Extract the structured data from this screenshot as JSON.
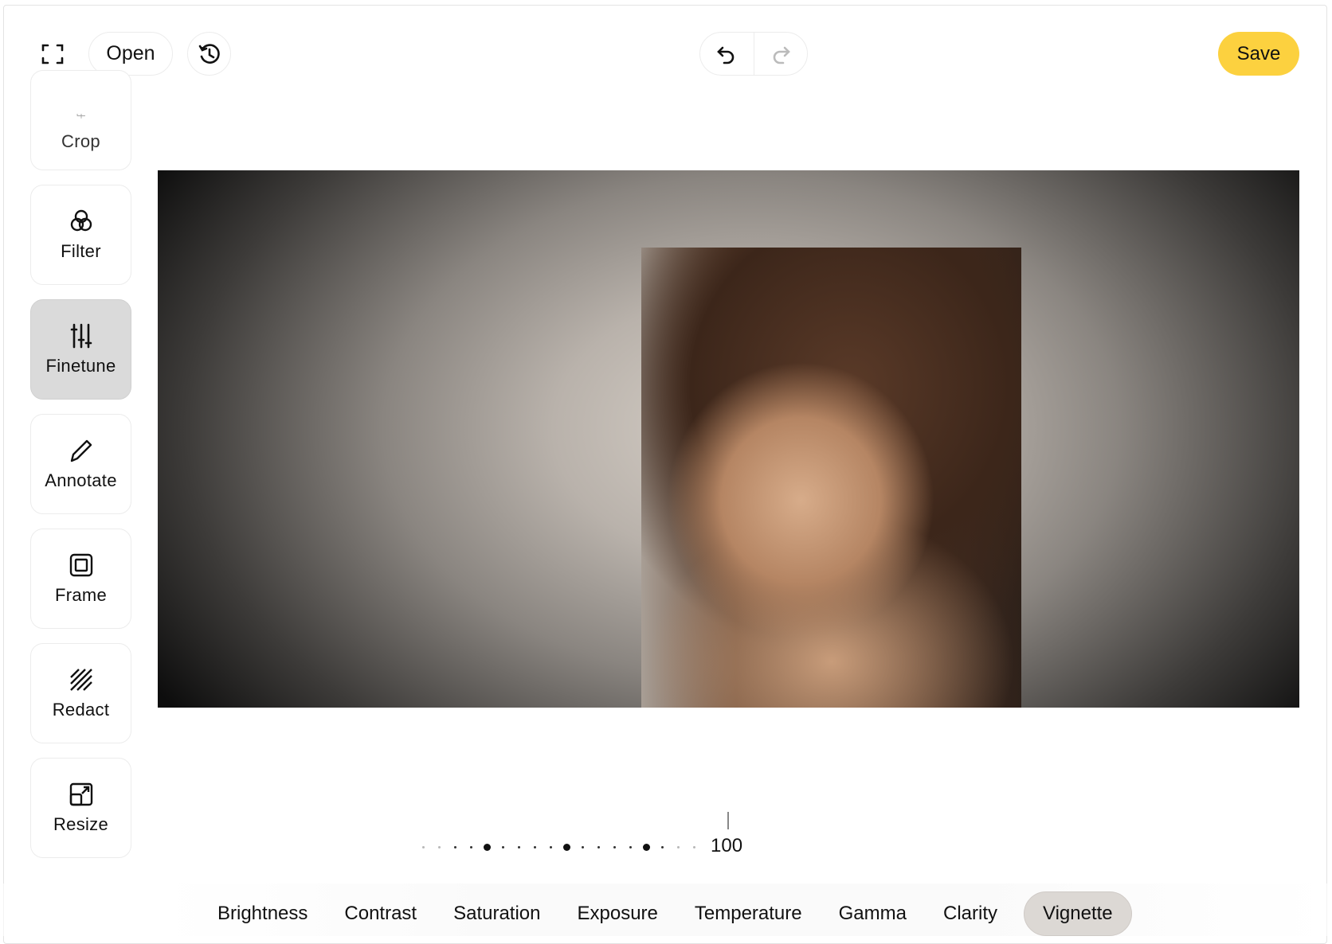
{
  "toolbar": {
    "open_label": "Open",
    "save_label": "Save",
    "icons": {
      "fullscreen": "fullscreen-icon",
      "history": "history-icon",
      "undo": "undo-icon",
      "redo": "redo-icon"
    },
    "save_color": "#fcd13f"
  },
  "sidebar": {
    "items": [
      {
        "label": "Crop",
        "icon": "crop-icon"
      },
      {
        "label": "Filter",
        "icon": "filter-icon"
      },
      {
        "label": "Finetune",
        "icon": "sliders-icon",
        "active": true
      },
      {
        "label": "Annotate",
        "icon": "pencil-icon"
      },
      {
        "label": "Frame",
        "icon": "frame-icon"
      },
      {
        "label": "Redact",
        "icon": "redact-icon"
      },
      {
        "label": "Resize",
        "icon": "resize-icon"
      }
    ]
  },
  "slider": {
    "value": "100"
  },
  "tabs": [
    {
      "label": "Brightness"
    },
    {
      "label": "Contrast"
    },
    {
      "label": "Saturation"
    },
    {
      "label": "Exposure"
    },
    {
      "label": "Temperature"
    },
    {
      "label": "Gamma"
    },
    {
      "label": "Clarity"
    },
    {
      "label": "Vignette",
      "active": true
    }
  ]
}
